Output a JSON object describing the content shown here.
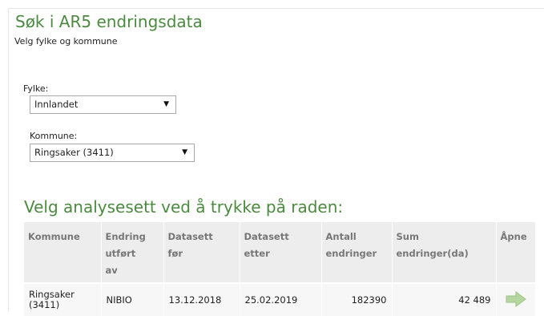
{
  "page": {
    "title": "Søk i AR5 endringsdata",
    "subtitle": "Velg fylke og kommune"
  },
  "form": {
    "fylke_label": "Fylke:",
    "fylke_value": "Innlandet",
    "kommune_label": "Kommune:",
    "kommune_value": "Ringsaker (3411)"
  },
  "results": {
    "heading": "Velg analysesett ved å trykke på raden:",
    "columns": [
      [
        "Kommune"
      ],
      [
        "Endring",
        "utført",
        "av"
      ],
      [
        "Datasett",
        "før"
      ],
      [
        "Datasett",
        "etter"
      ],
      [
        "Antall",
        "endringer"
      ],
      [
        "Sum",
        "endringer(da)"
      ],
      [
        "Åpne"
      ]
    ],
    "rows": [
      {
        "kommune": [
          "Ringsaker",
          "(3411)"
        ],
        "utfort_av": "NIBIO",
        "datasett_for": "13.12.2018",
        "datasett_etter": "25.02.2019",
        "antall": "182390",
        "sum": "42 489"
      }
    ]
  },
  "colors": {
    "heading_green": "#4b8a3f",
    "header_bg": "#ededed",
    "row_bg": "#f7f7f7",
    "open_arrow": "#b5d6a0"
  },
  "icons": {
    "open": "arrow-right-icon",
    "select": "triangle-down-icon"
  }
}
